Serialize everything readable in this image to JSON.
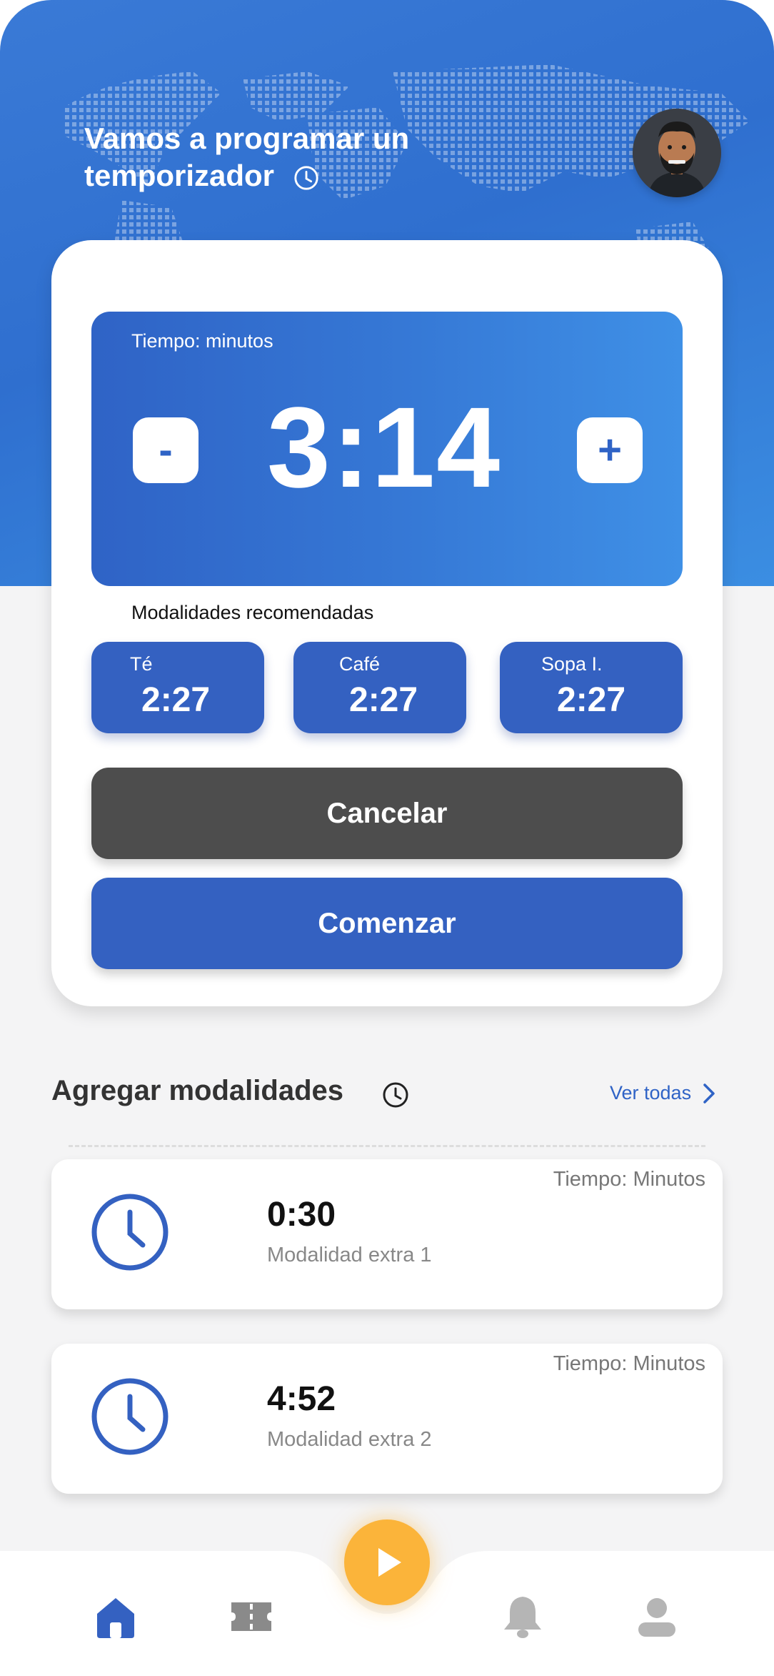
{
  "header": {
    "greeting": "Vamos a programar un temporizador"
  },
  "timer": {
    "label": "Tiempo: minutos",
    "value": "3:14",
    "minus_label": "-",
    "plus_label": "+"
  },
  "recommended": {
    "title": "Modalidades recomendadas",
    "items": [
      {
        "name": "Té",
        "time": "2:27"
      },
      {
        "name": "Café",
        "time": "2:27"
      },
      {
        "name": "Sopa I.",
        "time": "2:27"
      }
    ]
  },
  "actions": {
    "cancel_label": "Cancelar",
    "start_label": "Comenzar"
  },
  "modalities": {
    "title": "Agregar modalidades",
    "see_all_label": "Ver todas",
    "items": [
      {
        "unit": "Tiempo: Minutos",
        "time": "0:30",
        "name": "Modalidad extra 1"
      },
      {
        "unit": "Tiempo: Minutos",
        "time": "4:52",
        "name": "Modalidad extra 2"
      }
    ]
  },
  "colors": {
    "brand_blue": "#3461c1",
    "cancel_gray": "#4d4d4d",
    "play_orange": "#fbb43a"
  },
  "icons": {
    "header_clock": "clock-icon",
    "avatar": "avatar-icon",
    "section_clock": "clock-icon",
    "see_all": "chevron-right-icon",
    "modality": "clock-icon",
    "nav": [
      "home-icon",
      "ticket-icon",
      "play-icon",
      "bell-icon",
      "profile-icon"
    ]
  }
}
